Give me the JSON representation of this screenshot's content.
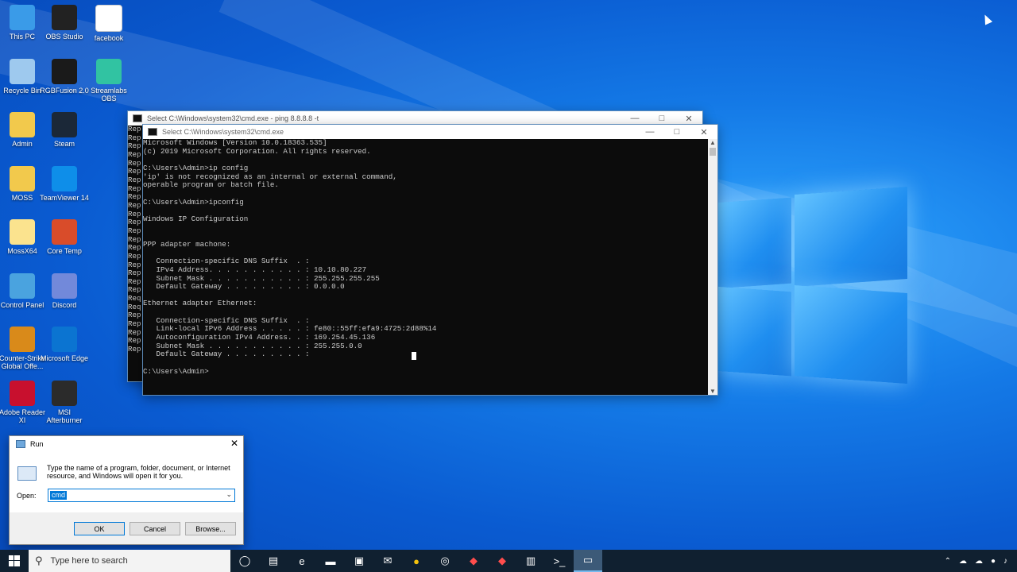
{
  "desktop": {
    "icons": [
      {
        "label": "This PC",
        "icon": "this-pc-icon",
        "color": "#3a9be8"
      },
      {
        "label": "OBS Studio",
        "icon": "obs-icon",
        "color": "#222222"
      },
      {
        "label": "facebook",
        "icon": "file-icon",
        "color": "#ffffff"
      },
      {
        "label": "Recycle Bin",
        "icon": "recycle-bin-icon",
        "color": "#9ec9ee"
      },
      {
        "label": "RGBFusion 2.0",
        "icon": "rgbfusion-icon",
        "color": "#1a1a1a"
      },
      {
        "label": "Streamlabs OBS",
        "icon": "streamlabs-icon",
        "color": "#31c3a2"
      },
      {
        "label": "Admin",
        "icon": "user-folder-icon",
        "color": "#f2c94c"
      },
      {
        "label": "Steam",
        "icon": "steam-icon",
        "color": "#1b2838"
      },
      {
        "label": "MOSS",
        "icon": "folder-icon",
        "color": "#f2c94c"
      },
      {
        "label": "TeamViewer 14",
        "icon": "teamviewer-icon",
        "color": "#0e8ee9"
      },
      {
        "label": "MossX64",
        "icon": "folder-icon",
        "color": "#fbe38e"
      },
      {
        "label": "Core Temp",
        "icon": "core-temp-icon",
        "color": "#d94c2a"
      },
      {
        "label": "Control Panel",
        "icon": "control-panel-icon",
        "color": "#4aa3df"
      },
      {
        "label": "Discord",
        "icon": "discord-icon",
        "color": "#7289da"
      },
      {
        "label": "Counter-Strike Global Offe...",
        "icon": "csgo-icon",
        "color": "#d98a1a"
      },
      {
        "label": "Microsoft Edge",
        "icon": "edge-icon",
        "color": "#0b74d1"
      },
      {
        "label": "Adobe Reader XI",
        "icon": "adobe-reader-icon",
        "color": "#c8102e"
      },
      {
        "label": "MSI Afterburner",
        "icon": "msi-afterburner-icon",
        "color": "#2b2b2b"
      }
    ]
  },
  "back_window": {
    "title": "Select C:\\Windows\\system32\\cmd.exe - ping  8.8.8.8 -t",
    "lines": "Rep\nRep\nRep\nRep\nRep\nRep\nRep\nRep\nRep\nRep\nRep\nRep\nRep\nRep\nRep\nRep\nRep\nRep\nRep\nRep\nReq\nReq\nRep\nRep\nRep\nRep\nRep"
  },
  "front_window": {
    "title": "Select C:\\Windows\\system32\\cmd.exe",
    "output": "Microsoft Windows [Version 10.0.18363.535]\n(c) 2019 Microsoft Corporation. All rights reserved.\n\nC:\\Users\\Admin>ip config\n'ip' is not recognized as an internal or external command,\noperable program or batch file.\n\nC:\\Users\\Admin>ipconfig\n\nWindows IP Configuration\n\n\nPPP adapter machone:\n\n   Connection-specific DNS Suffix  . :\n   IPv4 Address. . . . . . . . . . . : 10.10.80.227\n   Subnet Mask . . . . . . . . . . . : 255.255.255.255\n   Default Gateway . . . . . . . . . : 0.0.0.0\n\nEthernet adapter Ethernet:\n\n   Connection-specific DNS Suffix  . :\n   Link-local IPv6 Address . . . . . : fe80::55ff:efa9:4725:2d88%14\n   Autoconfiguration IPv4 Address. . : 169.254.45.136\n   Subnet Mask . . . . . . . . . . . : 255.255.0.0\n   Default Gateway . . . . . . . . . :\n\nC:\\Users\\Admin>"
  },
  "run_dialog": {
    "title": "Run",
    "description": "Type the name of a program, folder, document, or Internet resource, and Windows will open it for you.",
    "open_label": "Open:",
    "open_value": "cmd",
    "ok": "OK",
    "cancel": "Cancel",
    "browse": "Browse..."
  },
  "taskbar": {
    "search_placeholder": "Type here to search",
    "apps": [
      "task-view-icon",
      "edge-icon",
      "file-explorer-icon",
      "store-icon",
      "mail-icon",
      "chrome-icon",
      "obs-icon",
      "anydesk-icon",
      "anydesk-icon",
      "notepad-icon",
      "cmd-icon",
      "run-icon"
    ]
  }
}
